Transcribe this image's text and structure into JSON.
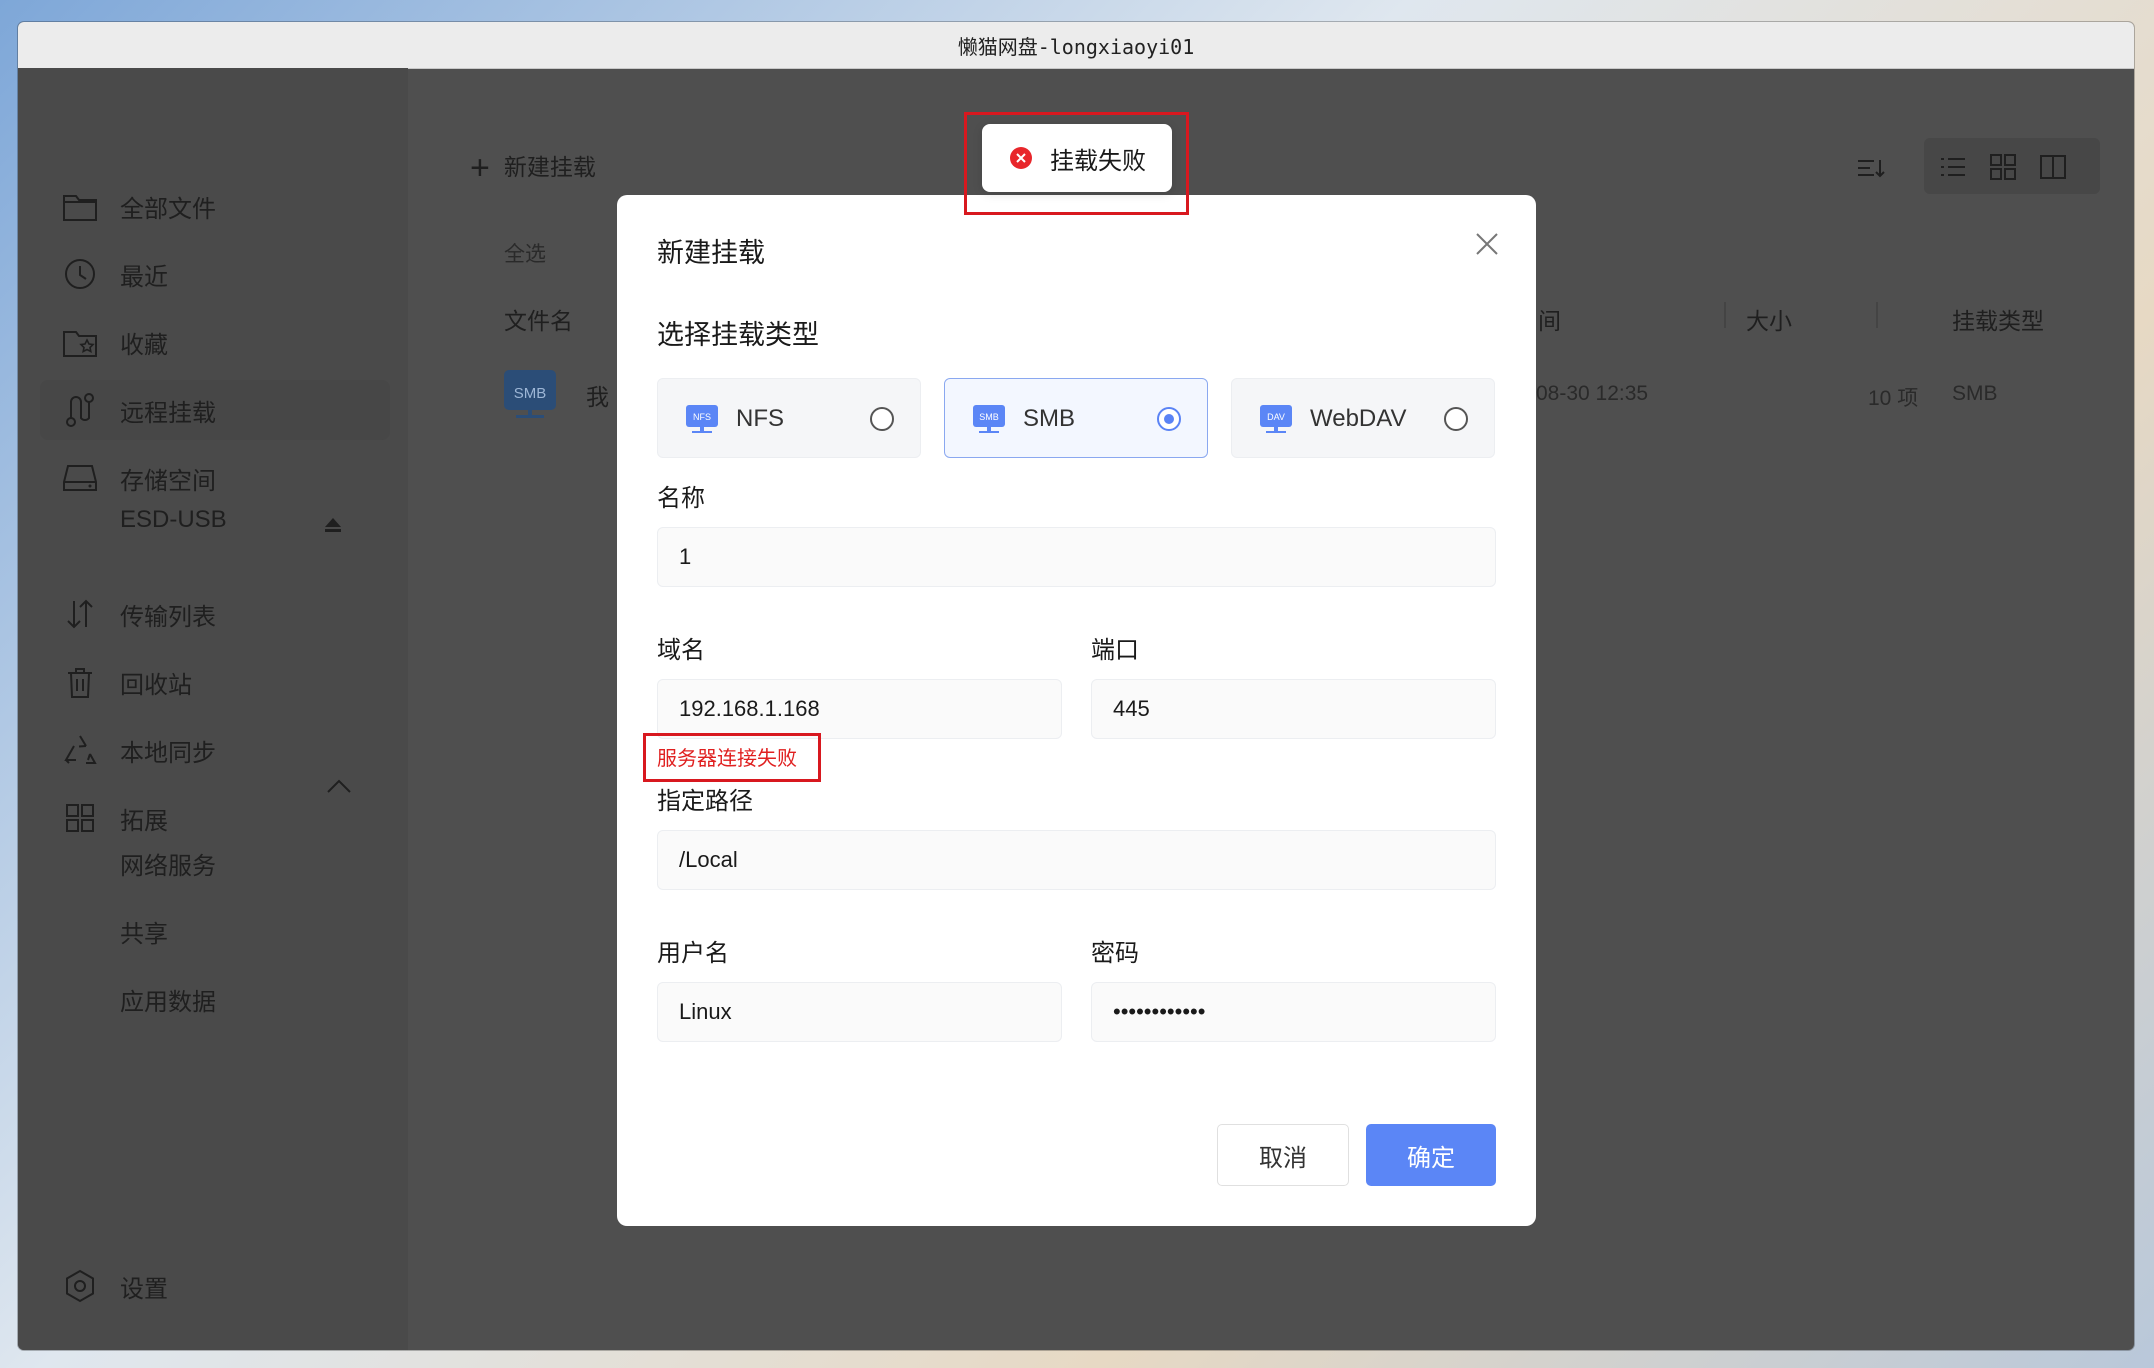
{
  "window": {
    "title": "懒猫网盘-longxiaoyi01"
  },
  "sidebar": {
    "items": [
      {
        "label": "全部文件",
        "icon": "folder-icon"
      },
      {
        "label": "最近",
        "icon": "history-icon"
      },
      {
        "label": "收藏",
        "icon": "star-folder-icon"
      },
      {
        "label": "远程挂载",
        "icon": "remote-mount-icon"
      },
      {
        "label": "存储空间",
        "icon": "drive-icon"
      },
      {
        "label": "传输列表",
        "icon": "transfer-icon"
      },
      {
        "label": "回收站",
        "icon": "trash-icon"
      },
      {
        "label": "本地同步",
        "icon": "sync-icon"
      },
      {
        "label": "拓展",
        "icon": "grid-icon"
      },
      {
        "label": "设置",
        "icon": "settings-icon"
      }
    ],
    "storage_sub": "ESD-USB",
    "extensions": [
      "网络服务",
      "共享",
      "应用数据"
    ]
  },
  "main": {
    "new_mount": "新建挂载",
    "select_all": "全选",
    "columns": {
      "name": "文件名",
      "time": "间",
      "size": "大小",
      "type": "挂载类型"
    },
    "row": {
      "name_prefix": "我",
      "icon_text": "SMB",
      "time": "08-30 12:35",
      "size": "10 项",
      "type": "SMB"
    }
  },
  "toast": {
    "message": "挂载失败"
  },
  "dialog": {
    "title": "新建挂载",
    "section": "选择挂载类型",
    "types": [
      {
        "label": "NFS",
        "badge": "NFS",
        "selected": false
      },
      {
        "label": "SMB",
        "badge": "SMB",
        "selected": true
      },
      {
        "label": "WebDAV",
        "badge": "DAV",
        "selected": false
      }
    ],
    "name_label": "名称",
    "name_value": "1",
    "domain_label": "域名",
    "domain_value": "192.168.1.168",
    "port_label": "端口",
    "port_value": "445",
    "error": "服务器连接失败",
    "path_label": "指定路径",
    "path_value": "/Local",
    "user_label": "用户名",
    "user_value": "Linux",
    "pass_label": "密码",
    "pass_value": "••••••••••••",
    "cancel": "取消",
    "confirm": "确定"
  },
  "colors": {
    "accent": "#5b86f6",
    "error": "#e02020",
    "annotation": "#d8181f"
  }
}
